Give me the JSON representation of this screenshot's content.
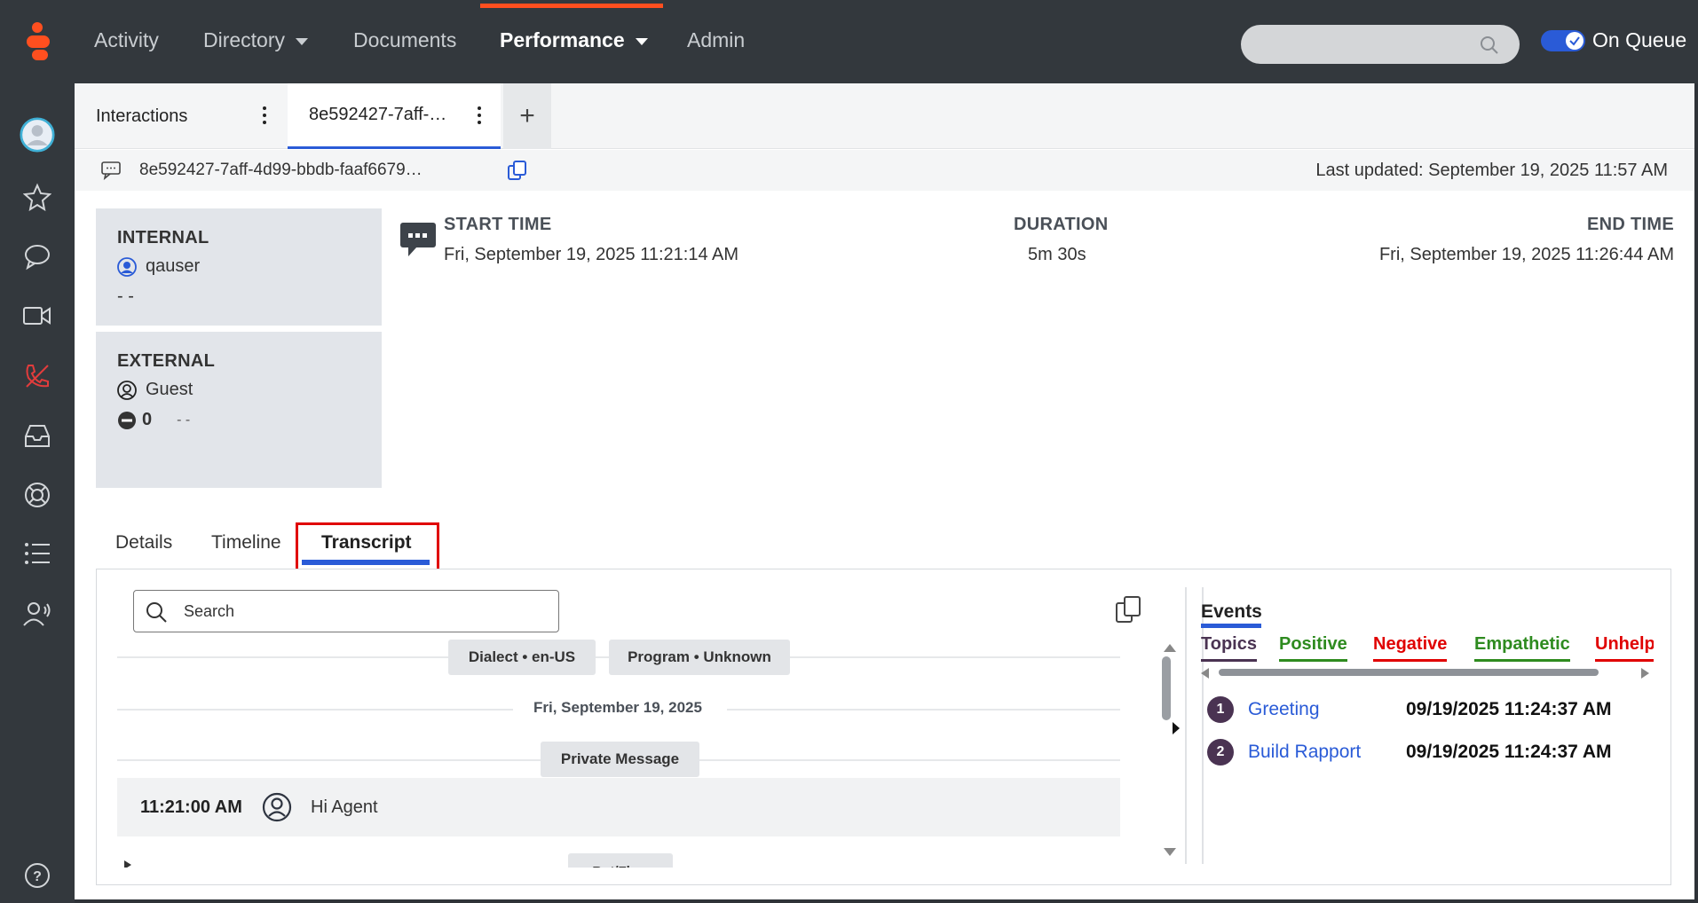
{
  "topnav": {
    "items": [
      {
        "label": "Activity"
      },
      {
        "label": "Directory"
      },
      {
        "label": "Documents"
      },
      {
        "label": "Performance"
      },
      {
        "label": "Admin"
      }
    ],
    "queue_label": "On Queue"
  },
  "tabs": {
    "interactions": "Interactions",
    "conversation": "8e592427-7aff-…",
    "add": "+"
  },
  "infobar": {
    "conversation_id": "8e592427-7aff-4d99-bbdb-faaf6679…",
    "last_updated": "Last updated: September 19, 2025 11:57 AM"
  },
  "internal": {
    "title": "INTERNAL",
    "user": "qauser",
    "detail": "- -"
  },
  "external": {
    "title": "EXTERNAL",
    "user": "Guest",
    "count": "0",
    "detail": "- -"
  },
  "meta": {
    "start_label": "START TIME",
    "start_value": "Fri, September 19, 2025 11:21:14 AM",
    "duration_label": "DURATION",
    "duration_value": "5m 30s",
    "end_label": "END TIME",
    "end_value": "Fri, September 19, 2025 11:26:44 AM"
  },
  "detail_tabs": [
    "Details",
    "Timeline",
    "Transcript"
  ],
  "transcript": {
    "search_placeholder": "Search",
    "dialect_chip": "Dialect • en-US",
    "program_chip": "Program • Unknown",
    "date_divider": "Fri, September 19, 2025",
    "private_chip": "Private Message",
    "message_time": "11:21:00 AM",
    "message_text": "Hi Agent",
    "partial_chip": "Bot/Flow"
  },
  "events": {
    "title": "Events",
    "filters": [
      {
        "label": "Topics",
        "color": "#4a3352"
      },
      {
        "label": "Positive",
        "color": "#2e8b1f"
      },
      {
        "label": "Negative",
        "color": "#e00000"
      },
      {
        "label": "Empathetic",
        "color": "#2e8b1f"
      },
      {
        "label": "Unhelp",
        "color": "#e00000"
      }
    ],
    "items": [
      {
        "num": "1",
        "name": "Greeting",
        "time": "09/19/2025 11:24:37 AM"
      },
      {
        "num": "2",
        "name": "Build Rapport",
        "time": "09/19/2025 11:24:37 AM"
      }
    ]
  },
  "colors": {
    "accent": "#2a5bd7",
    "brand": "#ff4f1f",
    "highlight": "#e00000"
  }
}
